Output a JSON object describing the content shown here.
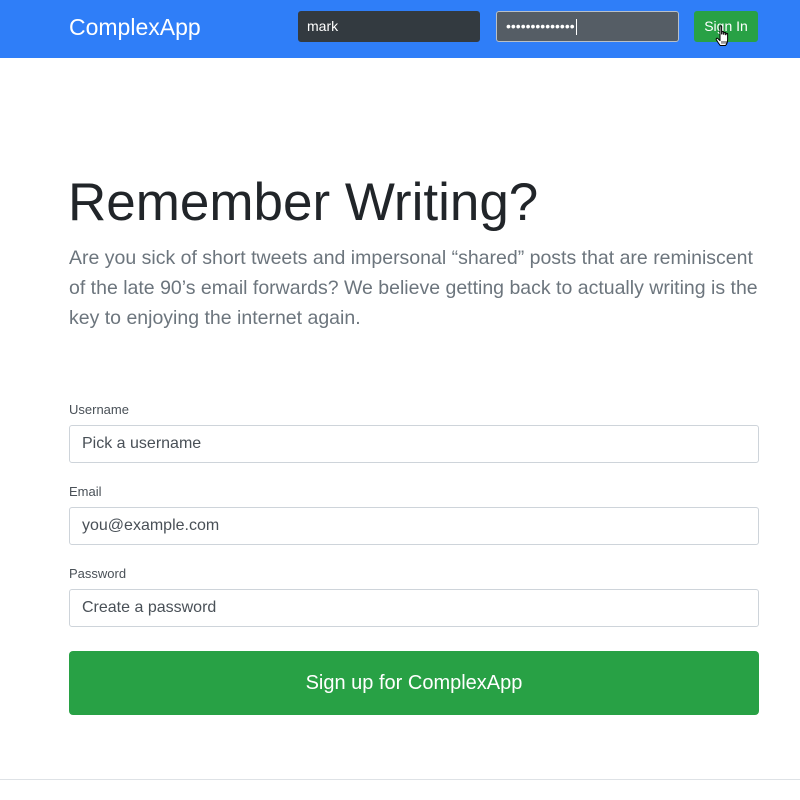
{
  "header": {
    "brand": "ComplexApp",
    "username_value": "mark",
    "password_mask": "••••••••••••••",
    "signin_label": "Sign In",
    "background_color": "#2f7ef8"
  },
  "hero": {
    "title": "Remember Writing?",
    "lead": "Are you sick of short tweets and impersonal “shared” posts that are reminiscent of the late 90’s email forwards? We believe getting back to actually writing is the key to enjoying the internet again."
  },
  "form": {
    "username": {
      "label": "Username",
      "placeholder": "Pick a username"
    },
    "email": {
      "label": "Email",
      "placeholder": "you@example.com"
    },
    "password": {
      "label": "Password",
      "placeholder": "Create a password"
    },
    "submit_label": "Sign up for ComplexApp",
    "submit_color": "#28a145"
  },
  "icons": {
    "cursor": "hand-pointer-icon"
  }
}
